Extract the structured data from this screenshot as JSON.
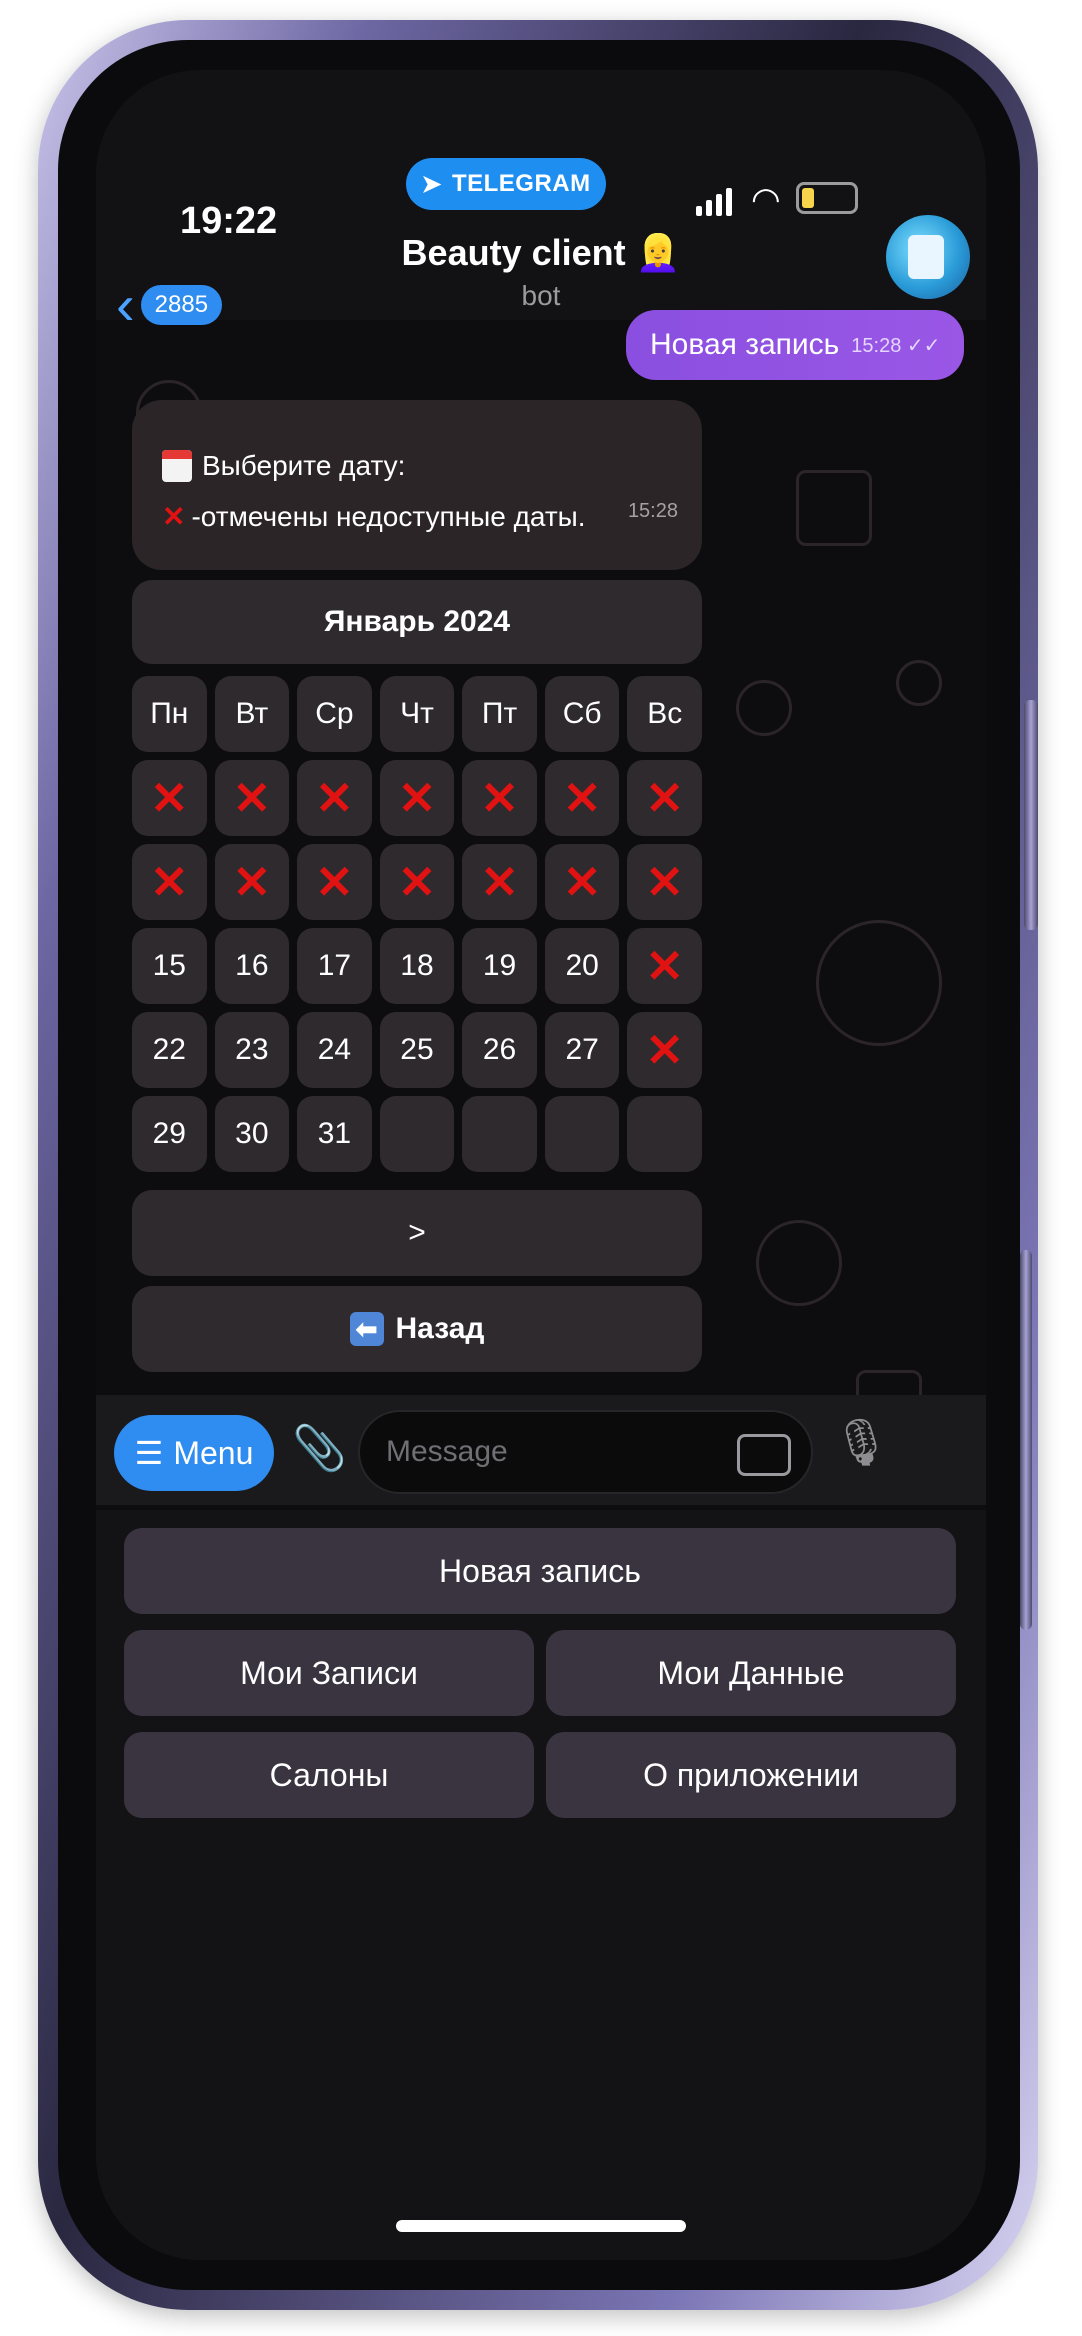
{
  "status_bar": {
    "time": "19:22",
    "app_pill": "TELEGRAM"
  },
  "header": {
    "back_count": "2885",
    "title": "Beauty client 👱‍♀️",
    "subtitle": "bot"
  },
  "outgoing_message": {
    "text": "Новая запись",
    "time": "15:28"
  },
  "incoming_message": {
    "line1": "Выберите дату:",
    "line2": "-отмечены недоступные даты.",
    "time": "15:28"
  },
  "calendar": {
    "month": "Январь 2024",
    "weekdays": [
      "Пн",
      "Вт",
      "Ср",
      "Чт",
      "Пт",
      "Сб",
      "Вс"
    ],
    "rows": [
      [
        "x",
        "x",
        "x",
        "x",
        "x",
        "x",
        "x"
      ],
      [
        "x",
        "x",
        "x",
        "x",
        "x",
        "x",
        "x"
      ],
      [
        "15",
        "16",
        "17",
        "18",
        "19",
        "20",
        "x"
      ],
      [
        "22",
        "23",
        "24",
        "25",
        "26",
        "27",
        "x"
      ],
      [
        "29",
        "30",
        "31",
        "",
        "",
        "",
        ""
      ]
    ],
    "next_label": ">",
    "back_label": "Назад"
  },
  "input_bar": {
    "menu_label": "Menu",
    "placeholder": "Message"
  },
  "reply_keyboard": {
    "new_booking": "Новая запись",
    "my_bookings": "Мои Записи",
    "my_data": "Мои Данные",
    "salons": "Салоны",
    "about": "О приложении"
  },
  "colors": {
    "accent": "#2f8cf0",
    "outgoing_bubble": "#9a57e6",
    "unavailable_mark": "#e11212"
  }
}
